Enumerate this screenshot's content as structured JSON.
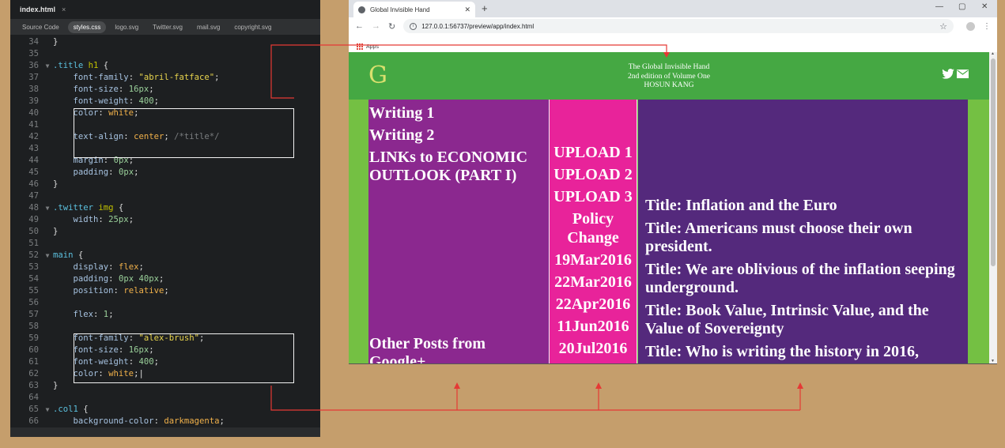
{
  "colors": {
    "background": "#c59e6c",
    "arrow": "#e53935",
    "header_green": "#45a843",
    "col1": "#8b288f",
    "col2": "#e8239a",
    "col3": "#54297c"
  },
  "editor": {
    "file_tab": "index.html",
    "file_tab_close": "×",
    "related_tabs": [
      "Source Code",
      "styles.css",
      "logo.svg",
      "Twitter.svg",
      "mail.svg",
      "copyright.svg"
    ],
    "active_related_tab": "styles.css",
    "lines": [
      {
        "n": "34",
        "fold": "",
        "parts": [
          [
            "plain",
            "}"
          ]
        ]
      },
      {
        "n": "35",
        "fold": "",
        "parts": []
      },
      {
        "n": "36",
        "fold": "▼",
        "parts": [
          [
            "sel",
            ".title "
          ],
          [
            "tag",
            "h1"
          ],
          [
            "plain",
            " {"
          ]
        ]
      },
      {
        "n": "37",
        "fold": "",
        "parts": [
          [
            "plain",
            "    "
          ],
          [
            "prop",
            "font-family"
          ],
          [
            "plain",
            ": "
          ],
          [
            "str",
            "\"abril-fatface\""
          ],
          [
            "plain",
            ";"
          ]
        ]
      },
      {
        "n": "38",
        "fold": "",
        "parts": [
          [
            "plain",
            "    "
          ],
          [
            "prop",
            "font-size"
          ],
          [
            "plain",
            ": "
          ],
          [
            "num",
            "16px"
          ],
          [
            "plain",
            ";"
          ]
        ]
      },
      {
        "n": "39",
        "fold": "",
        "parts": [
          [
            "plain",
            "    "
          ],
          [
            "prop",
            "font-weight"
          ],
          [
            "plain",
            ": "
          ],
          [
            "num",
            "400"
          ],
          [
            "plain",
            ";"
          ]
        ]
      },
      {
        "n": "40",
        "fold": "",
        "parts": [
          [
            "plain",
            "    "
          ],
          [
            "prop",
            "color"
          ],
          [
            "plain",
            ": "
          ],
          [
            "kw",
            "white"
          ],
          [
            "plain",
            ";"
          ]
        ]
      },
      {
        "n": "41",
        "fold": "",
        "parts": []
      },
      {
        "n": "42",
        "fold": "",
        "parts": [
          [
            "plain",
            "    "
          ],
          [
            "prop",
            "text-align"
          ],
          [
            "plain",
            ": "
          ],
          [
            "kw",
            "center"
          ],
          [
            "plain",
            "; "
          ],
          [
            "comment",
            "/*title*/"
          ]
        ]
      },
      {
        "n": "43",
        "fold": "",
        "parts": []
      },
      {
        "n": "44",
        "fold": "",
        "parts": [
          [
            "plain",
            "    "
          ],
          [
            "prop",
            "margin"
          ],
          [
            "plain",
            ": "
          ],
          [
            "num",
            "0px"
          ],
          [
            "plain",
            ";"
          ]
        ]
      },
      {
        "n": "45",
        "fold": "",
        "parts": [
          [
            "plain",
            "    "
          ],
          [
            "prop",
            "padding"
          ],
          [
            "plain",
            ": "
          ],
          [
            "num",
            "0px"
          ],
          [
            "plain",
            ";"
          ]
        ]
      },
      {
        "n": "46",
        "fold": "",
        "parts": [
          [
            "plain",
            "}"
          ]
        ]
      },
      {
        "n": "47",
        "fold": "",
        "parts": []
      },
      {
        "n": "48",
        "fold": "▼",
        "parts": [
          [
            "sel",
            ".twitter "
          ],
          [
            "tag",
            "img"
          ],
          [
            "plain",
            " {"
          ]
        ]
      },
      {
        "n": "49",
        "fold": "",
        "parts": [
          [
            "plain",
            "    "
          ],
          [
            "prop",
            "width"
          ],
          [
            "plain",
            ": "
          ],
          [
            "num",
            "25px"
          ],
          [
            "plain",
            ";"
          ]
        ]
      },
      {
        "n": "50",
        "fold": "",
        "parts": [
          [
            "plain",
            "}"
          ]
        ]
      },
      {
        "n": "51",
        "fold": "",
        "parts": []
      },
      {
        "n": "52",
        "fold": "▼",
        "parts": [
          [
            "sel",
            "main"
          ],
          [
            "plain",
            " {"
          ]
        ]
      },
      {
        "n": "53",
        "fold": "",
        "parts": [
          [
            "plain",
            "    "
          ],
          [
            "prop",
            "display"
          ],
          [
            "plain",
            ": "
          ],
          [
            "kw",
            "flex"
          ],
          [
            "plain",
            ";"
          ]
        ]
      },
      {
        "n": "54",
        "fold": "",
        "parts": [
          [
            "plain",
            "    "
          ],
          [
            "prop",
            "padding"
          ],
          [
            "plain",
            ": "
          ],
          [
            "num",
            "0px 40px"
          ],
          [
            "plain",
            ";"
          ]
        ]
      },
      {
        "n": "55",
        "fold": "",
        "parts": [
          [
            "plain",
            "    "
          ],
          [
            "prop",
            "position"
          ],
          [
            "plain",
            ": "
          ],
          [
            "kw",
            "relative"
          ],
          [
            "plain",
            ";"
          ]
        ]
      },
      {
        "n": "56",
        "fold": "",
        "parts": []
      },
      {
        "n": "57",
        "fold": "",
        "parts": [
          [
            "plain",
            "    "
          ],
          [
            "prop",
            "flex"
          ],
          [
            "plain",
            ": "
          ],
          [
            "num",
            "1"
          ],
          [
            "plain",
            ";"
          ]
        ]
      },
      {
        "n": "58",
        "fold": "",
        "parts": []
      },
      {
        "n": "59",
        "fold": "",
        "parts": [
          [
            "plain",
            "    "
          ],
          [
            "prop",
            "font-family"
          ],
          [
            "plain",
            ": "
          ],
          [
            "str",
            "\"alex-brush\""
          ],
          [
            "plain",
            ";"
          ]
        ]
      },
      {
        "n": "60",
        "fold": "",
        "parts": [
          [
            "plain",
            "    "
          ],
          [
            "prop",
            "font-size"
          ],
          [
            "plain",
            ": "
          ],
          [
            "num",
            "16px"
          ],
          [
            "plain",
            ";"
          ]
        ]
      },
      {
        "n": "61",
        "fold": "",
        "parts": [
          [
            "plain",
            "    "
          ],
          [
            "prop",
            "font-weight"
          ],
          [
            "plain",
            ": "
          ],
          [
            "num",
            "400"
          ],
          [
            "plain",
            ";"
          ]
        ]
      },
      {
        "n": "62",
        "fold": "",
        "parts": [
          [
            "plain",
            "    "
          ],
          [
            "prop",
            "color"
          ],
          [
            "plain",
            ": "
          ],
          [
            "kw",
            "white"
          ],
          [
            "plain",
            ";|"
          ]
        ]
      },
      {
        "n": "63",
        "fold": "",
        "parts": [
          [
            "plain",
            "}"
          ]
        ]
      },
      {
        "n": "64",
        "fold": "",
        "parts": []
      },
      {
        "n": "65",
        "fold": "▼",
        "parts": [
          [
            "sel",
            ".col1"
          ],
          [
            "plain",
            " {"
          ]
        ]
      },
      {
        "n": "66",
        "fold": "",
        "parts": [
          [
            "plain",
            "    "
          ],
          [
            "prop",
            "background-color"
          ],
          [
            "plain",
            ": "
          ],
          [
            "kw",
            "darkmagenta"
          ],
          [
            "plain",
            ";"
          ]
        ]
      }
    ]
  },
  "browser": {
    "tab_title": "Global Invisible Hand",
    "tab_close": "✕",
    "new_tab": "+",
    "window_controls": [
      "—",
      "▢",
      "✕"
    ],
    "url": "127.0.0.1:56737/preview/app/index.html",
    "bookmark_apps": "Apps",
    "site": {
      "logo": "G",
      "header_lines": [
        "The Global Invisible Hand",
        "2nd edition of Volume One",
        "HOSUN KANG"
      ],
      "col1_links": [
        "Writing 1",
        "Writing 2",
        "LINKs to ECONOMIC OUTLOOK (PART I)"
      ],
      "col1_bottom": "Other Posts from Google+",
      "col2_items": [
        "UPLOAD 1",
        "UPLOAD 2",
        "UPLOAD 3",
        "Policy Change",
        "19Mar2016",
        "22Mar2016",
        "22Apr2016",
        "11Jun2016",
        "20Jul2016"
      ],
      "col3_items": [
        "Title: Inflation and the Euro",
        "Title: Americans must choose their own president.",
        "Title: We are oblivious of the inflation seeping underground.",
        "Title: Book Value, Intrinsic Value, and the Value of Sovereignty",
        "Title: Who is writing the history in 2016,"
      ]
    }
  }
}
